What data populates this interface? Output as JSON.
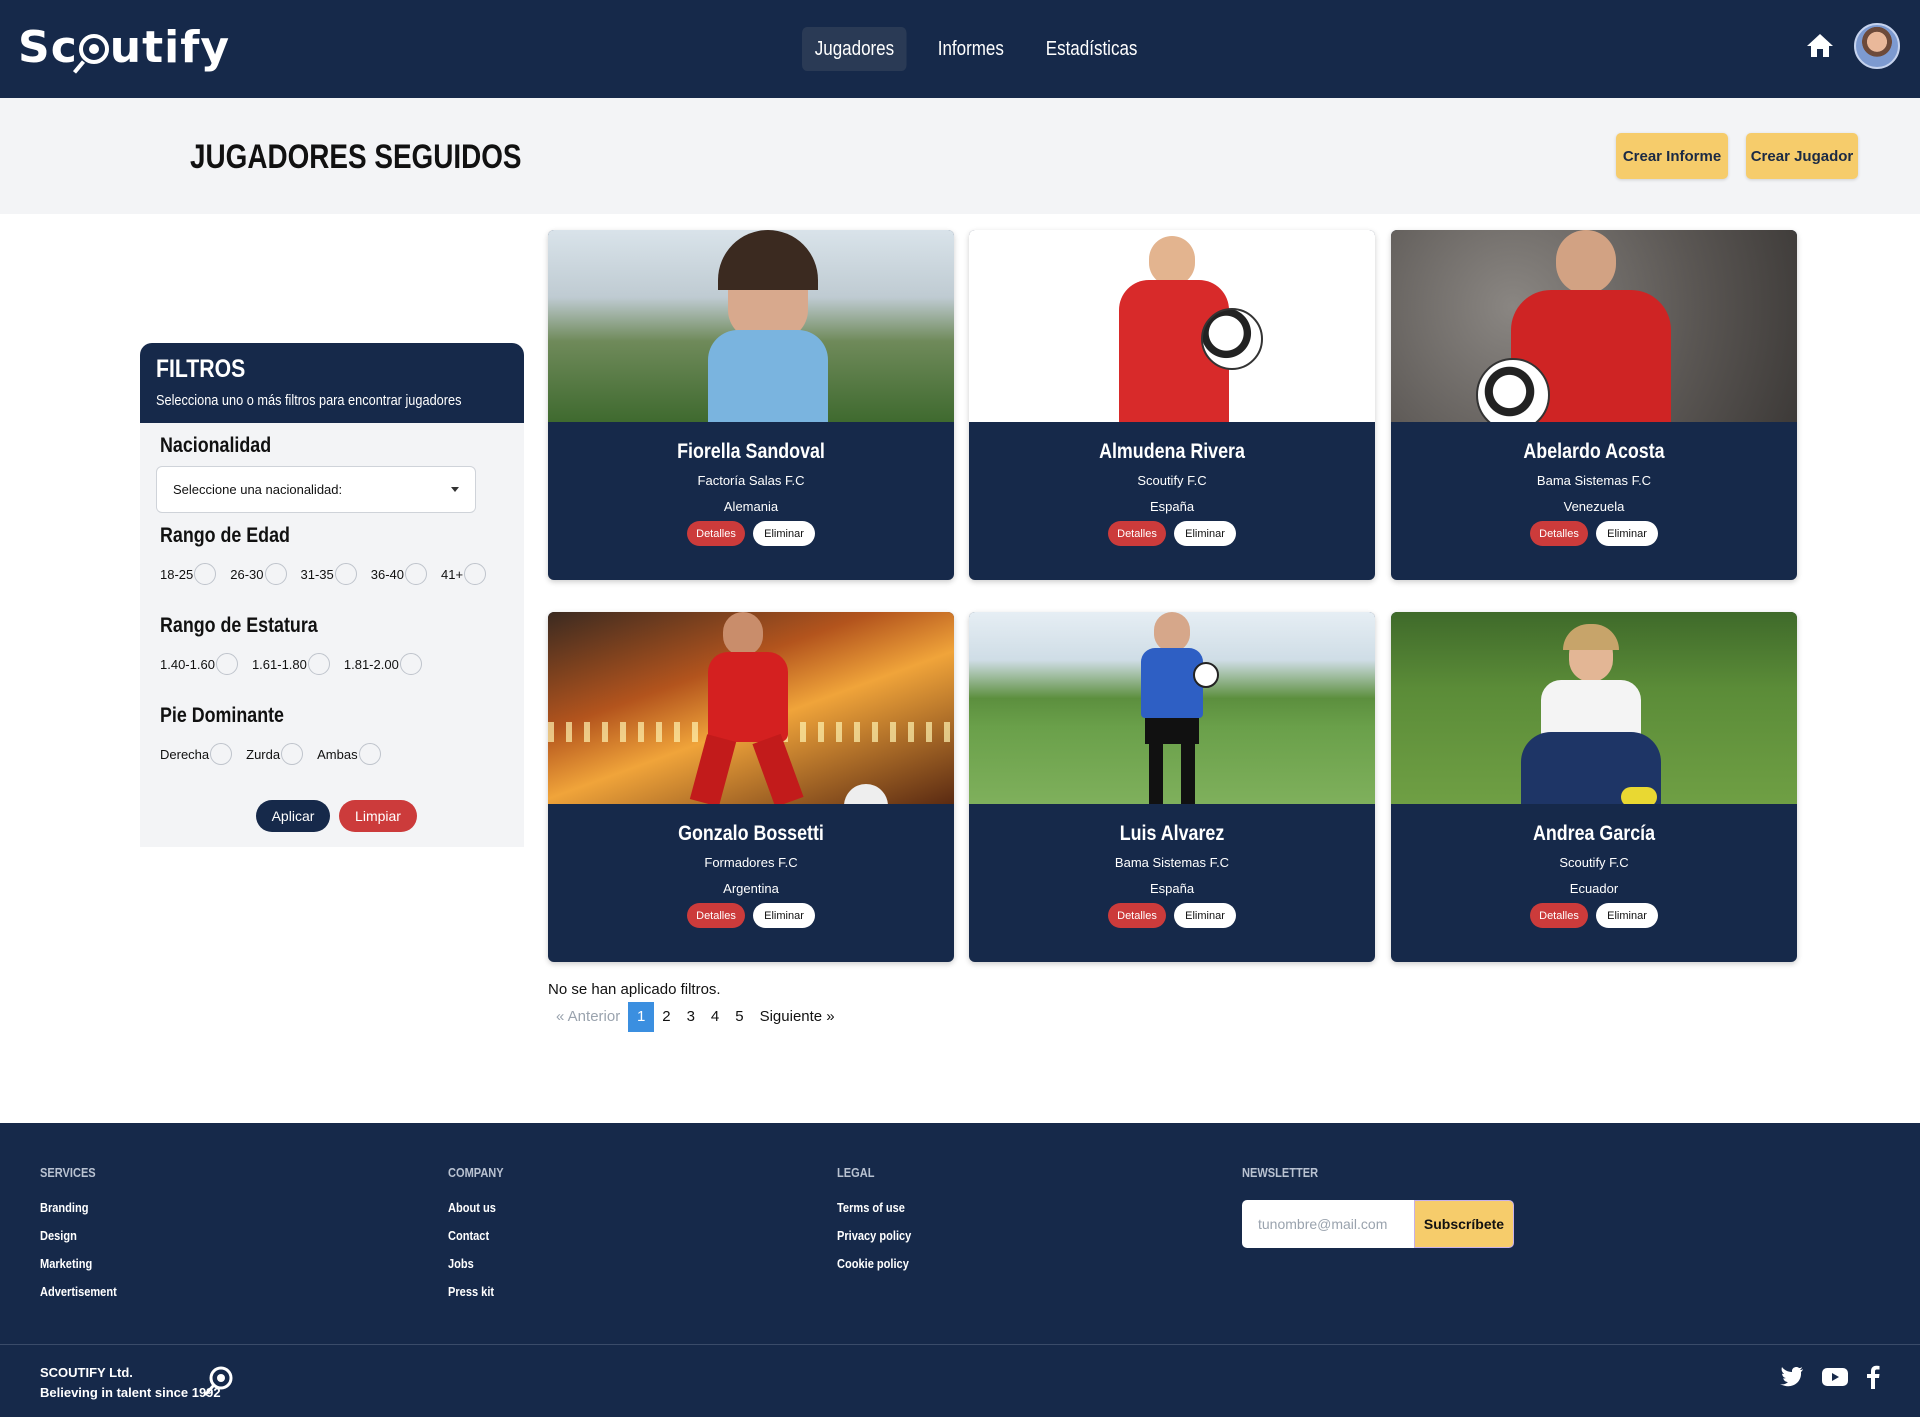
{
  "navbar": {
    "logo": "Scoutify",
    "links": [
      "Jugadores",
      "Informes",
      "Estadísticas"
    ],
    "active_link": "Jugadores"
  },
  "header": {
    "title": "JUGADORES SEGUIDOS",
    "crear_informe": "Crear Informe",
    "crear_jugador": "Crear Jugador"
  },
  "filters": {
    "title": "FILTROS",
    "subtitle": "Selecciona uno o más filtros para encontrar jugadores",
    "nacionalidad_label": "Nacionalidad",
    "nacionalidad_placeholder": "Seleccione una nacionalidad:",
    "edad_label": "Rango de Edad",
    "edad_options": [
      "18-25",
      "26-30",
      "31-35",
      "36-40",
      "41+"
    ],
    "estatura_label": "Rango de Estatura",
    "estatura_options": [
      "1.40-1.60",
      "1.61-1.80",
      "1.81-2.00"
    ],
    "pie_label": "Pie Dominante",
    "pie_options": [
      "Derecha",
      "Zurda",
      "Ambas"
    ],
    "aplicar": "Aplicar",
    "limpiar": "Limpiar"
  },
  "players": [
    {
      "name": "Fiorella Sandoval",
      "club": "Factoría Salas F.C",
      "country": "Alemania"
    },
    {
      "name": "Almudena Rivera",
      "club": "Scoutify F.C",
      "country": "España"
    },
    {
      "name": "Abelardo Acosta",
      "club": "Bama Sistemas F.C",
      "country": "Venezuela"
    },
    {
      "name": "Gonzalo Bossetti",
      "club": "Formadores F.C",
      "country": "Argentina"
    },
    {
      "name": "Luis Alvarez",
      "club": "Bama Sistemas F.C",
      "country": "España"
    },
    {
      "name": "Andrea García",
      "club": "Scoutify F.C",
      "country": "Ecuador"
    }
  ],
  "card_buttons": {
    "details": "Detalles",
    "remove": "Eliminar"
  },
  "no_filters_text": "No se han aplicado filtros.",
  "pagination": {
    "prev": "« Anterior",
    "pages": [
      "1",
      "2",
      "3",
      "4",
      "5"
    ],
    "current": "1",
    "next": "Siguiente »"
  },
  "footer": {
    "services_head": "SERVICES",
    "services": [
      "Branding",
      "Design",
      "Marketing",
      "Advertisement"
    ],
    "company_head": "COMPANY",
    "company": [
      "About us",
      "Contact",
      "Jobs",
      "Press kit"
    ],
    "legal_head": "LEGAL",
    "legal": [
      "Terms of use",
      "Privacy policy",
      "Cookie policy"
    ],
    "newsletter_head": "NEWSLETTER",
    "newsletter_placeholder": "tunombre@mail.com",
    "newsletter_button": "Subscríbete",
    "copyright_line1": "SCOUTIFY Ltd.",
    "copyright_line2": "Believing in talent since 1992"
  },
  "colors": {
    "navy": "#16294a",
    "yellow": "#f6cc6b",
    "red": "#cc3b3b",
    "blue_active": "#3b8fe0",
    "light_gray": "#f3f4f6"
  },
  "icons": [
    "home-icon",
    "avatar",
    "dropdown-caret-icon",
    "search-ball-icon",
    "twitter-icon",
    "youtube-icon",
    "facebook-icon"
  ]
}
